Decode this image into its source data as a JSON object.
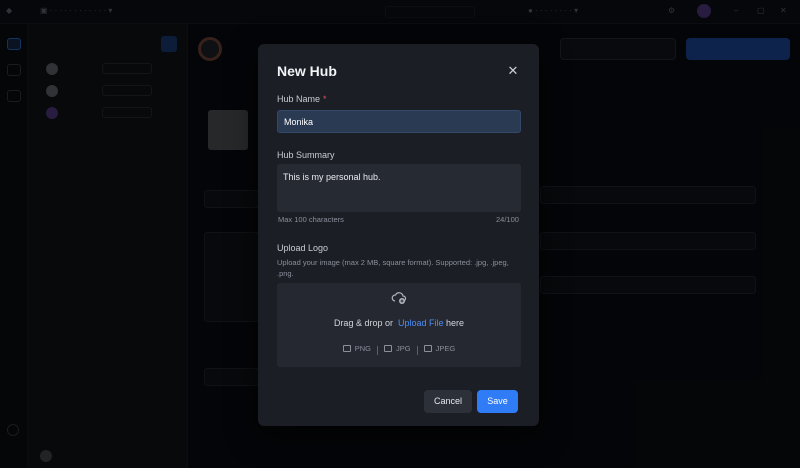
{
  "modal": {
    "title": "New Hub",
    "close_icon": "close-icon",
    "hub_name_label": "Hub Name",
    "required_mark": "*",
    "hub_name_value": "Monika",
    "hub_summary_label": "Hub Summary",
    "hub_summary_value": "This is my personal hub.",
    "summary_hint": "Max 100 characters",
    "summary_count": "24/100",
    "upload_label": "Upload Logo",
    "upload_desc": "Upload your image (max 2 MB, square format). Supported: .jpg, .jpeg, .png.",
    "dropzone_text": "Drag & drop or",
    "dropzone_link": "Upload File",
    "dropzone_suffix": "here",
    "formats": [
      "PNG",
      "JPG",
      "JPEG"
    ],
    "cancel_label": "Cancel",
    "save_label": "Save",
    "accent_color": "#2f7cf6",
    "required_color": "#e05260"
  }
}
